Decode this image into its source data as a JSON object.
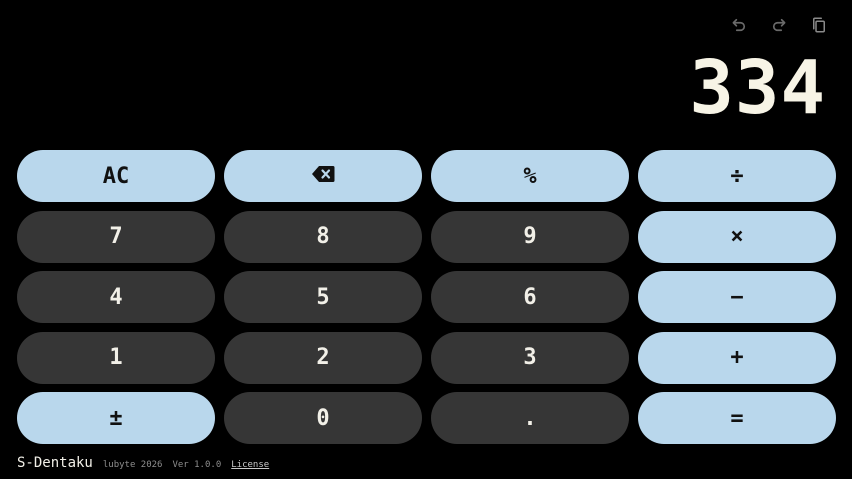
{
  "toolbar": {
    "undo_icon": "undo-icon",
    "redo_icon": "redo-icon",
    "copy_icon": "copy-icon"
  },
  "display": {
    "value": "334"
  },
  "keys": {
    "ac": "AC",
    "backspace_icon": "backspace-icon",
    "percent": "%",
    "divide": "÷",
    "seven": "7",
    "eight": "8",
    "nine": "9",
    "multiply": "×",
    "four": "4",
    "five": "5",
    "six": "6",
    "minus": "−",
    "one": "1",
    "two": "2",
    "three": "3",
    "plus": "+",
    "plus_minus": "±",
    "zero": "0",
    "decimal": ".",
    "equals": "="
  },
  "footer": {
    "app_name": "S-Dentaku",
    "copyright": "lubyte 2026",
    "version": "Ver 1.0.0",
    "license": "License"
  },
  "colors": {
    "background": "#000000",
    "accent_key": "#b9d7ec",
    "number_key": "#363636",
    "display_text": "#f7f4e6"
  }
}
